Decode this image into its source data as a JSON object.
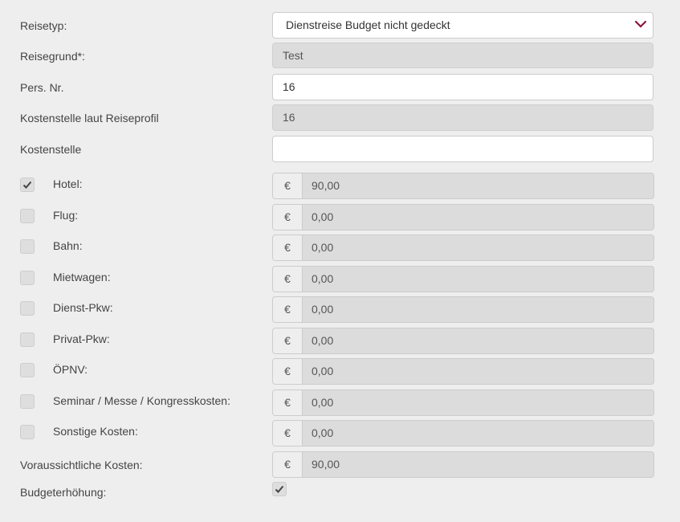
{
  "form": {
    "reisetyp": {
      "label": "Reisetyp:",
      "value": "Dienstreise Budget nicht gedeckt"
    },
    "reisegrund": {
      "label": "Reisegrund*:",
      "value": "Test"
    },
    "persnr": {
      "label": "Pers. Nr.",
      "value": "16"
    },
    "kostenstelle_profil": {
      "label": "Kostenstelle laut Reiseprofil",
      "value": "16"
    },
    "kostenstelle": {
      "label": "Kostenstelle",
      "value": ""
    },
    "currency_symbol": "€",
    "costs": [
      {
        "label": "Hotel:",
        "value": "90,00",
        "checked": true
      },
      {
        "label": "Flug:",
        "value": "0,00",
        "checked": false
      },
      {
        "label": "Bahn:",
        "value": "0,00",
        "checked": false
      },
      {
        "label": "Mietwagen:",
        "value": "0,00",
        "checked": false
      },
      {
        "label": "Dienst-Pkw:",
        "value": "0,00",
        "checked": false
      },
      {
        "label": "Privat-Pkw:",
        "value": "0,00",
        "checked": false
      },
      {
        "label": "ÖPNV:",
        "value": "0,00",
        "checked": false
      },
      {
        "label": "Seminar / Messe / Kongresskosten:",
        "value": "0,00",
        "checked": false
      },
      {
        "label": "Sonstige Kosten:",
        "value": "0,00",
        "checked": false
      }
    ],
    "voraussichtlich": {
      "label": "Voraussichtliche Kosten:",
      "value": "90,00"
    },
    "budgeterhoehung": {
      "label": "Budgeterhöhung:",
      "checked": true
    }
  },
  "colors": {
    "accent": "#8a1538",
    "readonly_bg": "#dcdcdc",
    "page_bg": "#eeeeee"
  }
}
